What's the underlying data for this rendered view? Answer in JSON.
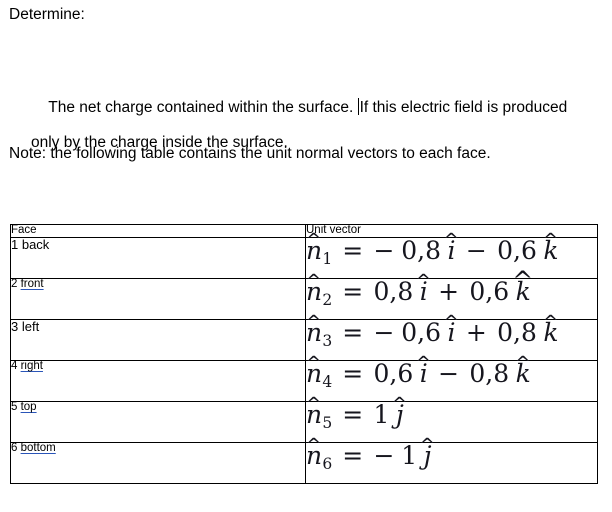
{
  "document": {
    "heading": "Determine:",
    "body_paragraph": {
      "before_caret": "The net charge contained within the surface. ",
      "after_caret": "If this electric field is produced only by the charge inside the surface."
    },
    "note_paragraph": "Note: the following table contains the unit normal vectors to each face."
  },
  "table": {
    "headers": {
      "face": "Face",
      "unit_vector": "Unit vector"
    },
    "rows": [
      {
        "index": "1",
        "face": "back",
        "misspelled": false,
        "vector": {
          "symbol": "n",
          "subscript": "1",
          "terms": [
            {
              "sign": "−",
              "magnitude": "0,8",
              "basis": "i",
              "hat": "narrow"
            },
            {
              "sign": "−",
              "magnitude": "0,6",
              "basis": "k",
              "hat": "narrow"
            }
          ],
          "plain": "n̂₁ = −0,8 î − 0,6 k̂"
        }
      },
      {
        "index": "2",
        "face": "front",
        "misspelled": true,
        "vector": {
          "symbol": "n",
          "subscript": "2",
          "terms": [
            {
              "sign": "",
              "magnitude": "0,8",
              "basis": "i",
              "hat": "narrow"
            },
            {
              "sign": "+",
              "magnitude": "0,6",
              "basis": "k",
              "hat": "wide"
            }
          ],
          "plain": "n̂₂ = 0,8 î + 0,6 k̂"
        }
      },
      {
        "index": "3",
        "face": "left",
        "misspelled": false,
        "vector": {
          "symbol": "n",
          "subscript": "3",
          "terms": [
            {
              "sign": "−",
              "magnitude": "0,6",
              "basis": "i",
              "hat": "narrow"
            },
            {
              "sign": "+",
              "magnitude": "0,8",
              "basis": "k",
              "hat": "narrow"
            }
          ],
          "plain": "n̂₃ = −0,6 î + 0,8 k̂"
        }
      },
      {
        "index": "4",
        "face": "right",
        "misspelled": true,
        "vector": {
          "symbol": "n",
          "subscript": "4",
          "terms": [
            {
              "sign": "",
              "magnitude": "0,6",
              "basis": "i",
              "hat": "narrow"
            },
            {
              "sign": "−",
              "magnitude": "0,8",
              "basis": "k",
              "hat": "narrow"
            }
          ],
          "plain": "n̂₄ = 0,6 î − 0,8 k̂"
        }
      },
      {
        "index": "5",
        "face": "top",
        "misspelled": true,
        "vector": {
          "symbol": "n",
          "subscript": "5",
          "terms": [
            {
              "sign": "",
              "magnitude": "1",
              "basis": "j",
              "hat": "narrow"
            }
          ],
          "plain": "n̂₅ = 1 ĵ"
        }
      },
      {
        "index": "6",
        "face": "bottom",
        "misspelled": true,
        "vector": {
          "symbol": "n",
          "subscript": "6",
          "terms": [
            {
              "sign": "−",
              "magnitude": "1",
              "basis": "j",
              "hat": "narrow"
            }
          ],
          "plain": "n̂₆ = −1 ĵ"
        }
      }
    ]
  },
  "colors": {
    "text": "#000000",
    "formula": "#16161e",
    "misspell_underline": "#2a55b8",
    "table_border": "#000000",
    "background": "#ffffff"
  }
}
